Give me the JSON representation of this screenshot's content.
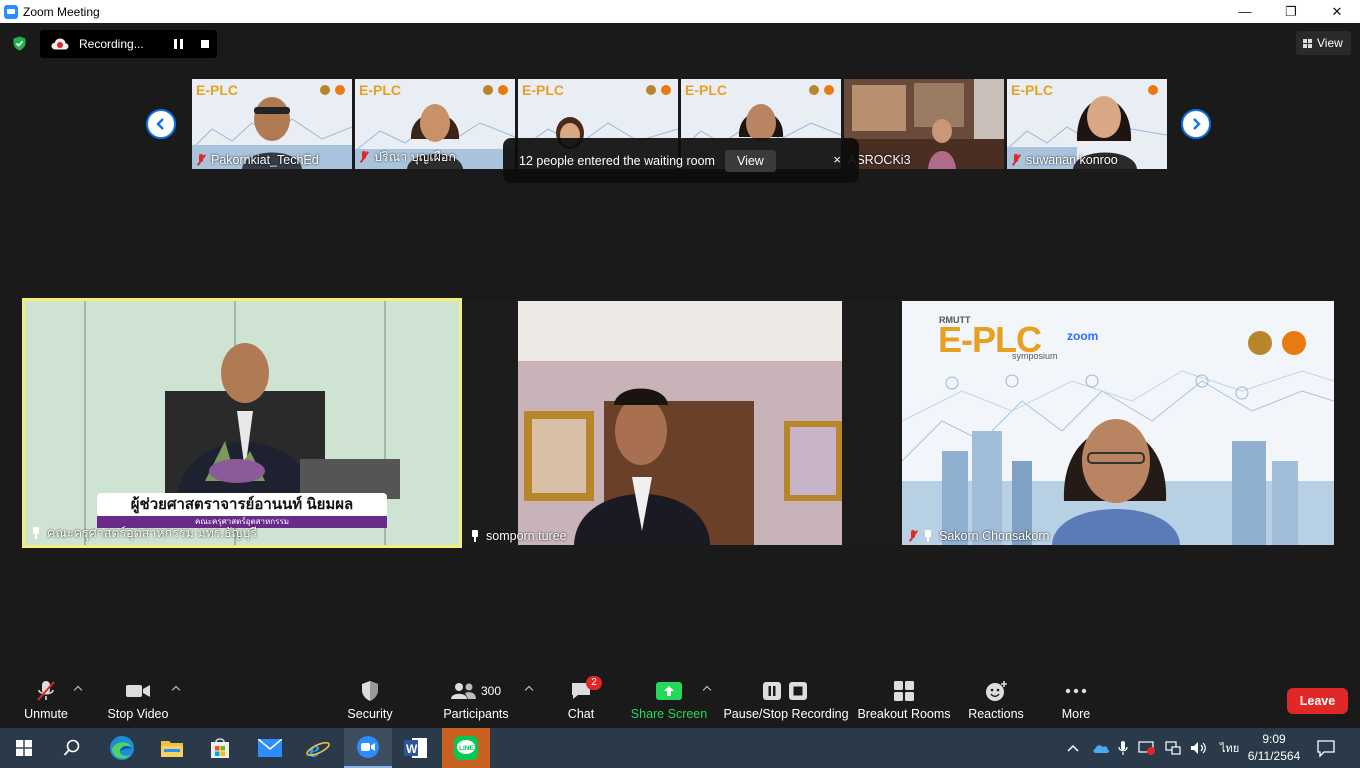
{
  "window": {
    "title": "Zoom Meeting",
    "minimize": "—",
    "maximize": "❐",
    "close": "✕"
  },
  "recording": {
    "label": "Recording..."
  },
  "view_button": {
    "label": "View"
  },
  "strip": {
    "tiles": [
      {
        "name": "Pakornkiat_TechEd"
      },
      {
        "name": "ปริณา บุญเผือก"
      },
      {
        "name": ""
      },
      {
        "name": ""
      },
      {
        "name": "ASROCKi3"
      },
      {
        "name": "suwanan konroo"
      }
    ]
  },
  "toast": {
    "message": "12 people entered the waiting room",
    "action": "View",
    "close": "×"
  },
  "main_tiles": [
    {
      "name": "คณะครุศาสตร์อุตสาหกรรม มทร.ธัญบุรี",
      "lower_third": "ผู้ช่วยศาสตราจารย์อานนท์ นิยมผล",
      "lower_sub": "คณะครุศาสตร์อุตสาหกรรม"
    },
    {
      "name": "somporn turee"
    },
    {
      "name": "Sakorn  Chonsakorn",
      "banner_small": "RMUTT",
      "banner_big": "E-PLC",
      "banner_sub": "symposium",
      "zoom_word": "zoom"
    }
  ],
  "toolbar": {
    "unmute": "Unmute",
    "stop_video": "Stop Video",
    "security": "Security",
    "participants": "Participants",
    "participants_count": "300",
    "chat": "Chat",
    "chat_badge": "2",
    "share_screen": "Share Screen",
    "pause_stop_recording": "Pause/Stop Recording",
    "breakout_rooms": "Breakout Rooms",
    "reactions": "Reactions",
    "more": "More",
    "leave": "Leave"
  },
  "taskbar": {
    "time": "9:09",
    "date": "6/11/2564",
    "language": "ไทย",
    "apps": [
      "start-icon",
      "search-icon",
      "edge-icon",
      "file-explorer-icon",
      "store-icon",
      "mail-icon",
      "ie-icon",
      "zoom-icon",
      "word-icon",
      "line-icon"
    ]
  },
  "colors": {
    "accent": "#0e72ed",
    "leave": "#e02828",
    "share": "#23d959",
    "active_speaker": "#f4ee78"
  }
}
